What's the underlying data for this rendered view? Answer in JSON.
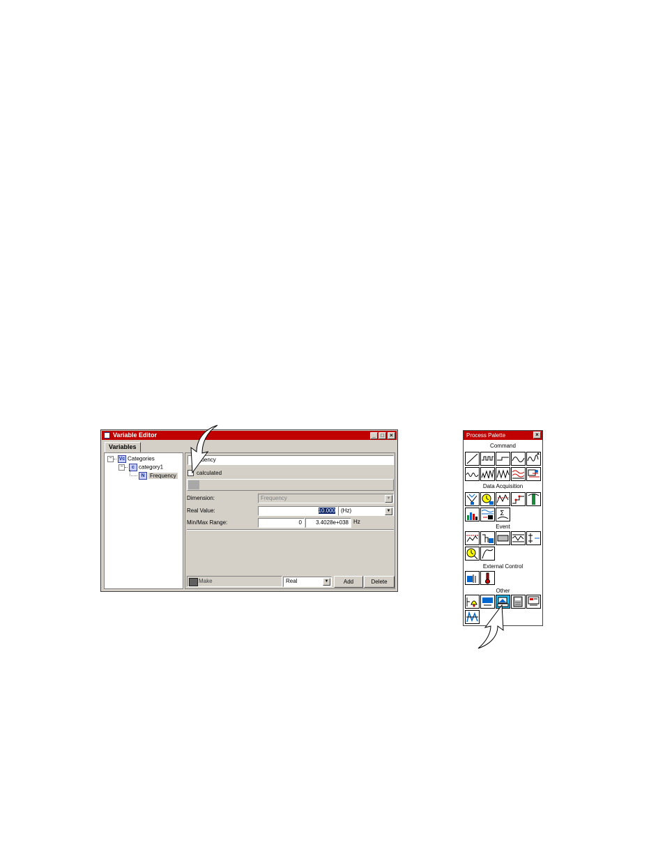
{
  "variable_editor": {
    "title": "Variable Editor",
    "tab": "Variables",
    "tree": {
      "root": "Categories",
      "category": "category1",
      "variable": "Frequency",
      "root_icon": "Vc",
      "category_icon": "c",
      "variable_icon": "N"
    },
    "name_value": "quency",
    "calculated_label": "calculated",
    "dimension_label": "Dimension:",
    "dimension_value": "Frequency",
    "real_value_label": "Real Value:",
    "real_value": "10.000",
    "real_value_unit": "(Hz)",
    "range_label": "Min/Max Range:",
    "range_min": "0",
    "range_max": "3.4028e+038",
    "range_unit": "Hz",
    "make_label": "Make",
    "type_value": "Real",
    "add_label": "Add",
    "delete_label": "Delete",
    "window_buttons": {
      "minimize": "_",
      "maximize": "□",
      "close": "×"
    }
  },
  "process_palette": {
    "title": "Process Palette",
    "close": "×",
    "sections": [
      "Command",
      "Data Acquisition",
      "Event",
      "External Control",
      "Other"
    ],
    "highlight_color": "#2bb7e6"
  },
  "colors": {
    "title_bar": "#c00000",
    "chrome": "#d4d0c8"
  }
}
